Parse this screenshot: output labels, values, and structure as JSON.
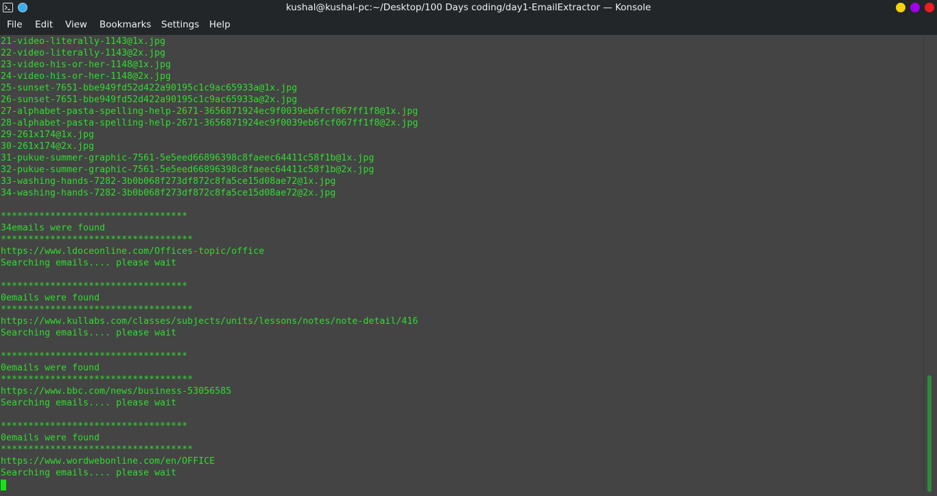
{
  "window": {
    "title": "kushal@kushal-pc:~/Desktop/100 Days coding/day1-EmailExtractor — Konsole",
    "icons": [
      "terminal-icon",
      "pin-icon",
      "minimize-icon",
      "maximize-icon",
      "close-icon"
    ],
    "colors": {
      "minimize": "#f5d50a",
      "maximize": "#a000e6",
      "close": "#ee1c1c"
    }
  },
  "menubar": {
    "items": [
      "File",
      "Edit",
      "View",
      "Bookmarks",
      "Settings",
      "Help"
    ]
  },
  "terminal": {
    "text_color": "#2fdc2f",
    "background": "#444444",
    "lines": [
      "21-video-literally-1143@1x.jpg",
      "22-video-literally-1143@2x.jpg",
      "23-video-his-or-her-1148@1x.jpg",
      "24-video-his-or-her-1148@2x.jpg",
      "25-sunset-7651-bbe949fd52d422a90195c1c9ac65933a@1x.jpg",
      "26-sunset-7651-bbe949fd52d422a90195c1c9ac65933a@2x.jpg",
      "27-alphabet-pasta-spelling-help-2671-3656871924ec9f0039eb6fcf067ff1f8@1x.jpg",
      "28-alphabet-pasta-spelling-help-2671-3656871924ec9f0039eb6fcf067ff1f8@2x.jpg",
      "29-261x174@1x.jpg",
      "30-261x174@2x.jpg",
      "31-pukue-summer-graphic-7561-5e5eed66896398c8faeec64411c58f1b@1x.jpg",
      "32-pukue-summer-graphic-7561-5e5eed66896398c8faeec64411c58f1b@2x.jpg",
      "33-washing-hands-7282-3b0b068f273df872c8fa5ce15d08ae72@1x.jpg",
      "34-washing-hands-7282-3b0b068f273df872c8fa5ce15d08ae72@2x.jpg",
      "",
      "**********************************",
      "34emails were found",
      "***********************************",
      "https://www.ldoceonline.com/Offices-topic/office",
      "Searching emails.... please wait",
      "",
      "**********************************",
      "0emails were found",
      "***********************************",
      "https://www.kullabs.com/classes/subjects/units/lessons/notes/note-detail/416",
      "Searching emails.... please wait",
      "",
      "**********************************",
      "0emails were found",
      "***********************************",
      "https://www.bbc.com/news/business-53056585",
      "Searching emails.... please wait",
      "",
      "**********************************",
      "0emails were found",
      "***********************************",
      "https://www.wordwebonline.com/en/OFFICE",
      "Searching emails.... please wait"
    ]
  },
  "scrollbar": {
    "position_fraction": 0.74,
    "thumb_color": "#2e8a3a"
  }
}
